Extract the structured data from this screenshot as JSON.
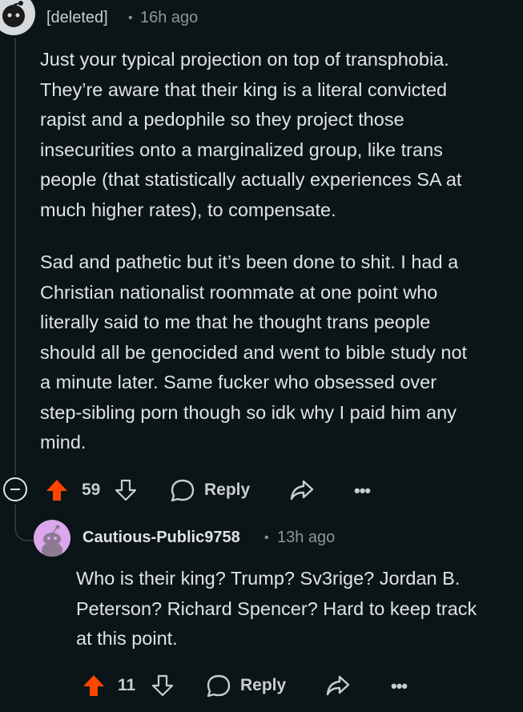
{
  "comment1": {
    "author": "[deleted]",
    "separator": "•",
    "time": "16h ago",
    "lines": [
      "Just your typical projection on top of transphobia.",
      "They’re aware that their king is a literal convicted",
      "rapist and a pedophile so they project those",
      "insecurities onto a marginalized group, like trans",
      "people (that statistically actually experiences SA at",
      "much higher rates), to compensate.",
      "Sad and pathetic but it’s been done to shit. I had a",
      "Christian nationalist roommate at one point who",
      "literally said to me that he thought trans people",
      "should all be genocided and went to bible study not",
      "a minute later. Same fucker who obsessed over",
      "step-sibling porn though so idk why I paid him any",
      "mind."
    ],
    "votes": "59",
    "reply_label": "Reply",
    "more_label": "•••"
  },
  "comment2": {
    "author": "Cautious-Public9758",
    "separator": "•",
    "time": "13h ago",
    "lines": [
      "Who is their king? Trump? Sv3rige? Jordan B.",
      "Peterson? Richard Spencer? Hard to keep track",
      "at this point."
    ],
    "votes": "11",
    "reply_label": "Reply",
    "more_label": "•••"
  },
  "colors": {
    "background": "#0b1416",
    "upvote_active": "#ff4500",
    "text": "#dfe3e6",
    "muted": "#8b969c"
  },
  "icons": [
    "snoo-avatar-icon",
    "collapse-icon",
    "upvote-icon",
    "downvote-icon",
    "reply-bubble-icon",
    "share-icon",
    "more-icon"
  ]
}
